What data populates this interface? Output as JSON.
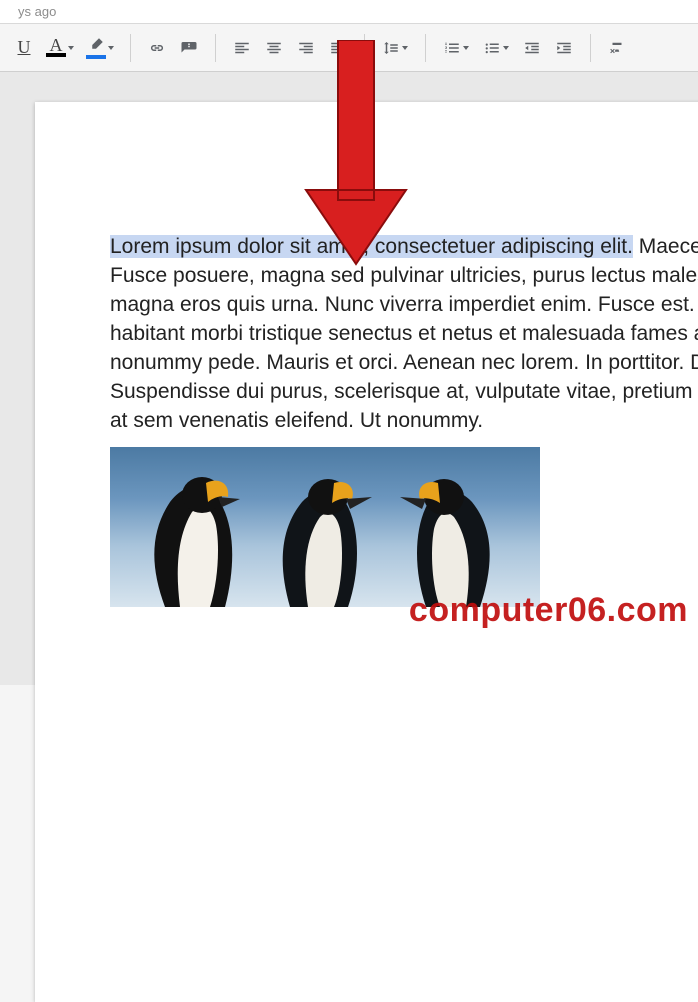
{
  "header": {
    "edit_info": "ys ago"
  },
  "toolbar": {
    "underline_tooltip": "Underline",
    "text_color_tooltip": "Text color",
    "highlight_tooltip": "Highlight color",
    "link_tooltip": "Insert link",
    "comment_tooltip": "Add comment",
    "align_left_tooltip": "Align left",
    "align_center_tooltip": "Align center",
    "align_right_tooltip": "Align right",
    "align_justify_tooltip": "Justify",
    "line_spacing_tooltip": "Line spacing",
    "num_list_tooltip": "Numbered list",
    "bullet_list_tooltip": "Bulleted list",
    "dec_indent_tooltip": "Decrease indent",
    "inc_indent_tooltip": "Increase indent",
    "clear_fmt_tooltip": "Clear formatting"
  },
  "document": {
    "selected_text": "Lorem ipsum dolor sit amet, consectetuer adipiscing elit.",
    "rest_line1": " Maecen",
    "line2": "Fusce posuere, magna sed pulvinar ultricies, purus lectus males",
    "line3": "magna eros quis urna. Nunc viverra imperdiet enim. Fusce est. V",
    "line4": "habitant morbi tristique senectus et netus et malesuada fames a",
    "line5": "nonummy pede. Mauris et orci. Aenean nec lorem. In porttitor. D",
    "line6": "Suspendisse dui purus, scelerisque at, vulputate vitae, pretium m",
    "line7": "at sem venenatis eleifend. Ut nonummy.",
    "image_alt": "penguins-image"
  },
  "overlay": {
    "arrow_color": "#d81f1f",
    "watermark_text": "computer06.com"
  }
}
